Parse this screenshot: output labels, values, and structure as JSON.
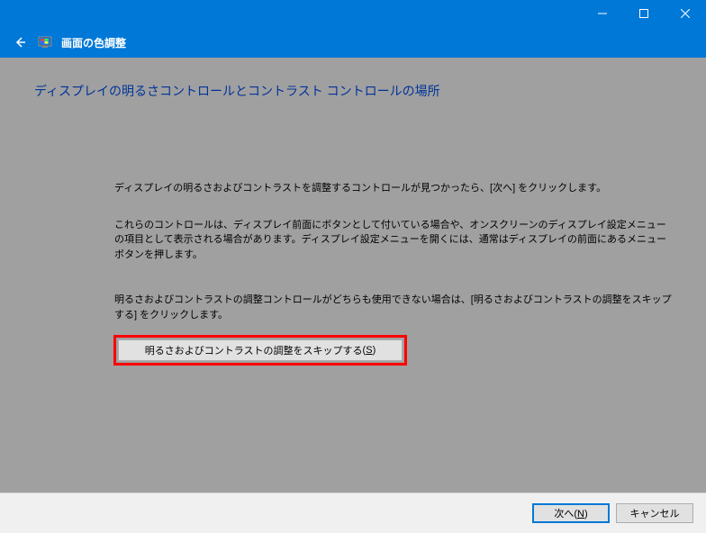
{
  "header": {
    "title": "画面の色調整"
  },
  "page": {
    "heading": "ディスプレイの明るさコントロールとコントラスト コントロールの場所",
    "para1": "ディスプレイの明るさおよびコントラストを調整するコントロールが見つかったら、[次へ] をクリックします。",
    "para2": "これらのコントロールは、ディスプレイ前面にボタンとして付いている場合や、オンスクリーンのディスプレイ設定メニューの項目として表示される場合があります。ディスプレイ設定メニューを開くには、通常はディスプレイの前面にあるメニュー ボタンを押します。",
    "para3": "明るさおよびコントラストの調整コントロールがどちらも使用できない場合は、[明るさおよびコントラストの調整をスキップする] をクリックします。",
    "skip_button_label": "明るさおよびコントラストの調整をスキップする",
    "skip_button_accel": "S"
  },
  "footer": {
    "next_label": "次へ",
    "next_accel": "N",
    "cancel_label": "キャンセル"
  }
}
